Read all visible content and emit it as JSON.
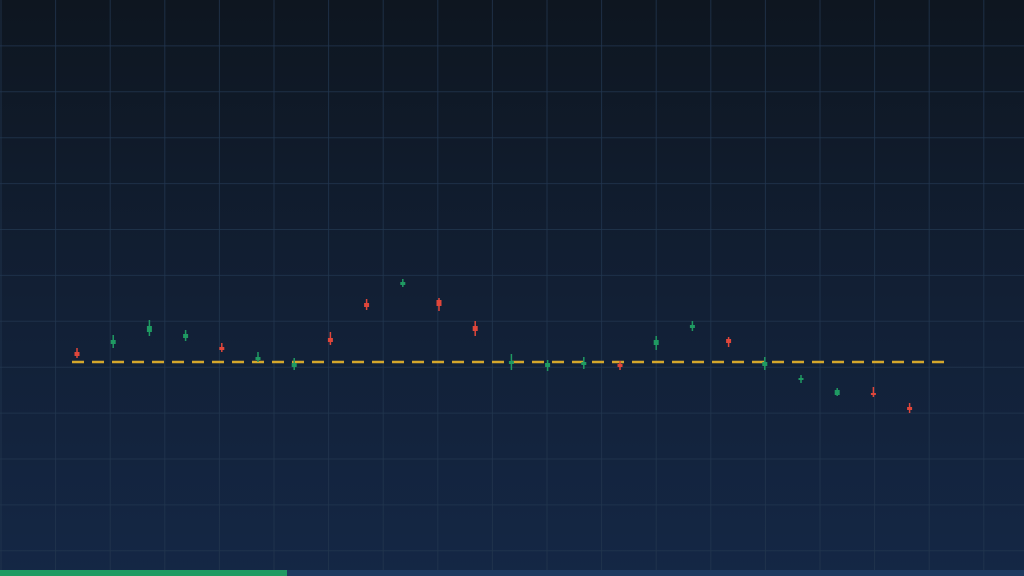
{
  "colors": {
    "up": "#1f9a62",
    "down": "#e0463a",
    "baseline": "#d4a72c",
    "grid": "#22364f",
    "progress_fill": "#1f9a62",
    "progress_track": "#1d3a5f"
  },
  "progress": {
    "fraction": 0.28
  },
  "chart_data": {
    "type": "candlestick",
    "grid": true,
    "ylim": [
      0,
      576
    ],
    "baseline": 214,
    "candles": [
      {
        "i": 0,
        "open": 220,
        "close": 224,
        "high": 228,
        "low": 218,
        "dir": "down"
      },
      {
        "i": 1,
        "open": 232,
        "close": 236,
        "high": 241,
        "low": 228,
        "dir": "up"
      },
      {
        "i": 2,
        "open": 244,
        "close": 250,
        "high": 256,
        "low": 240,
        "dir": "up"
      },
      {
        "i": 3,
        "open": 238,
        "close": 242,
        "high": 246,
        "low": 235,
        "dir": "up"
      },
      {
        "i": 4,
        "open": 226,
        "close": 229,
        "high": 233,
        "low": 224,
        "dir": "down"
      },
      {
        "i": 5,
        "open": 216,
        "close": 219,
        "high": 224,
        "low": 214,
        "dir": "up"
      },
      {
        "i": 6,
        "open": 209,
        "close": 213,
        "high": 218,
        "low": 206,
        "dir": "up"
      },
      {
        "i": 7,
        "open": 234,
        "close": 238,
        "high": 244,
        "low": 231,
        "dir": "down"
      },
      {
        "i": 8,
        "open": 269,
        "close": 273,
        "high": 277,
        "low": 266,
        "dir": "down"
      },
      {
        "i": 9,
        "open": 291,
        "close": 294,
        "high": 297,
        "low": 289,
        "dir": "up"
      },
      {
        "i": 10,
        "open": 270,
        "close": 276,
        "high": 278,
        "low": 265,
        "dir": "down"
      },
      {
        "i": 11,
        "open": 245,
        "close": 250,
        "high": 255,
        "low": 240,
        "dir": "down"
      },
      {
        "i": 12,
        "open": 212,
        "close": 215,
        "high": 222,
        "low": 206,
        "dir": "up"
      },
      {
        "i": 13,
        "open": 209,
        "close": 213,
        "high": 216,
        "low": 205,
        "dir": "up"
      },
      {
        "i": 14,
        "open": 211,
        "close": 214,
        "high": 219,
        "low": 207,
        "dir": "up"
      },
      {
        "i": 15,
        "open": 209,
        "close": 212,
        "high": 215,
        "low": 206,
        "dir": "down"
      },
      {
        "i": 16,
        "open": 231,
        "close": 236,
        "high": 240,
        "low": 226,
        "dir": "up"
      },
      {
        "i": 17,
        "open": 248,
        "close": 251,
        "high": 255,
        "low": 245,
        "dir": "up"
      },
      {
        "i": 18,
        "open": 233,
        "close": 237,
        "high": 239,
        "low": 229,
        "dir": "down"
      },
      {
        "i": 19,
        "open": 210,
        "close": 214,
        "high": 219,
        "low": 206,
        "dir": "up"
      },
      {
        "i": 20,
        "open": 196,
        "close": 198,
        "high": 201,
        "low": 193,
        "dir": "up"
      },
      {
        "i": 21,
        "open": 181,
        "close": 186,
        "high": 188,
        "low": 180,
        "dir": "up"
      },
      {
        "i": 22,
        "open": 181,
        "close": 183,
        "high": 189,
        "low": 179,
        "dir": "down"
      },
      {
        "i": 23,
        "open": 166,
        "close": 169,
        "high": 173,
        "low": 163,
        "dir": "down"
      }
    ]
  }
}
